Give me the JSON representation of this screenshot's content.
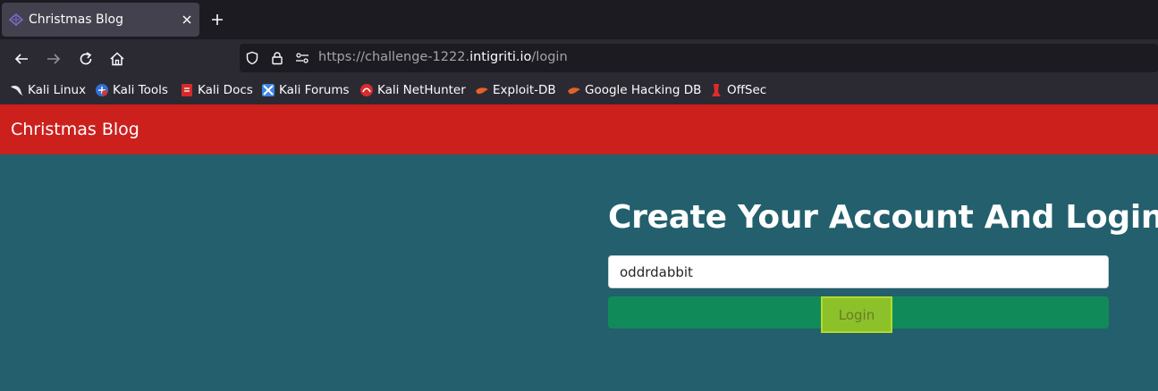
{
  "browser": {
    "tab_title": "Christmas Blog",
    "url_scheme_host_prefix": "https://challenge-1222.",
    "url_domain": "intigriti.io",
    "url_path": "/login",
    "bookmarks": [
      {
        "label": "Kali Linux",
        "icon": "kali-dragon-icon"
      },
      {
        "label": "Kali Tools",
        "icon": "kali-tools-icon"
      },
      {
        "label": "Kali Docs",
        "icon": "kali-docs-icon"
      },
      {
        "label": "Kali Forums",
        "icon": "kali-forums-icon"
      },
      {
        "label": "Kali NetHunter",
        "icon": "kali-nethunter-icon"
      },
      {
        "label": "Exploit-DB",
        "icon": "exploit-db-icon"
      },
      {
        "label": "Google Hacking DB",
        "icon": "ghdb-icon"
      },
      {
        "label": "OffSec",
        "icon": "offsec-icon"
      }
    ]
  },
  "site": {
    "brand": "Christmas Blog",
    "heading": "Create Your Account And Login!",
    "username_value": "oddrdabbit",
    "login_label": "Login"
  },
  "colors": {
    "header_red": "#cc201d",
    "page_teal": "#235f6d",
    "button_green": "#118a5a",
    "highlight": "#8cc129"
  }
}
